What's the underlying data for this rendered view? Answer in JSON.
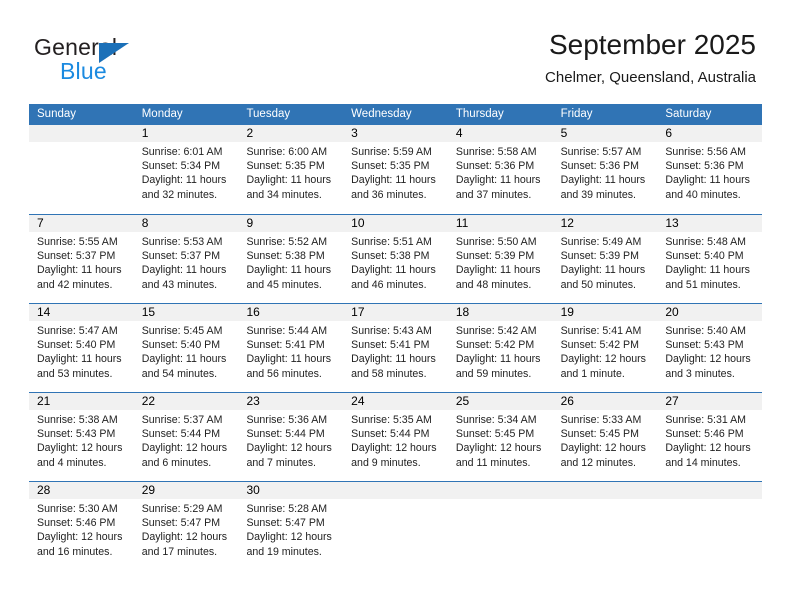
{
  "brand": {
    "name_part1": "General",
    "name_part2": "Blue",
    "triangle_color": "#1b70b8",
    "blue_text_color": "#1b8ae0"
  },
  "header": {
    "title": "September 2025",
    "location": "Chelmer, Queensland, Australia"
  },
  "theme": {
    "header_blue": "#3074b5",
    "day_number_bg": "#f1f1f1",
    "text_color": "#222222"
  },
  "weekdays": [
    "Sunday",
    "Monday",
    "Tuesday",
    "Wednesday",
    "Thursday",
    "Friday",
    "Saturday"
  ],
  "weeks": [
    [
      {
        "day": "",
        "sunrise": "",
        "sunset": "",
        "daylight_line1": "",
        "daylight_line2": ""
      },
      {
        "day": "1",
        "sunrise": "Sunrise: 6:01 AM",
        "sunset": "Sunset: 5:34 PM",
        "daylight_line1": "Daylight: 11 hours",
        "daylight_line2": "and 32 minutes."
      },
      {
        "day": "2",
        "sunrise": "Sunrise: 6:00 AM",
        "sunset": "Sunset: 5:35 PM",
        "daylight_line1": "Daylight: 11 hours",
        "daylight_line2": "and 34 minutes."
      },
      {
        "day": "3",
        "sunrise": "Sunrise: 5:59 AM",
        "sunset": "Sunset: 5:35 PM",
        "daylight_line1": "Daylight: 11 hours",
        "daylight_line2": "and 36 minutes."
      },
      {
        "day": "4",
        "sunrise": "Sunrise: 5:58 AM",
        "sunset": "Sunset: 5:36 PM",
        "daylight_line1": "Daylight: 11 hours",
        "daylight_line2": "and 37 minutes."
      },
      {
        "day": "5",
        "sunrise": "Sunrise: 5:57 AM",
        "sunset": "Sunset: 5:36 PM",
        "daylight_line1": "Daylight: 11 hours",
        "daylight_line2": "and 39 minutes."
      },
      {
        "day": "6",
        "sunrise": "Sunrise: 5:56 AM",
        "sunset": "Sunset: 5:36 PM",
        "daylight_line1": "Daylight: 11 hours",
        "daylight_line2": "and 40 minutes."
      }
    ],
    [
      {
        "day": "7",
        "sunrise": "Sunrise: 5:55 AM",
        "sunset": "Sunset: 5:37 PM",
        "daylight_line1": "Daylight: 11 hours",
        "daylight_line2": "and 42 minutes."
      },
      {
        "day": "8",
        "sunrise": "Sunrise: 5:53 AM",
        "sunset": "Sunset: 5:37 PM",
        "daylight_line1": "Daylight: 11 hours",
        "daylight_line2": "and 43 minutes."
      },
      {
        "day": "9",
        "sunrise": "Sunrise: 5:52 AM",
        "sunset": "Sunset: 5:38 PM",
        "daylight_line1": "Daylight: 11 hours",
        "daylight_line2": "and 45 minutes."
      },
      {
        "day": "10",
        "sunrise": "Sunrise: 5:51 AM",
        "sunset": "Sunset: 5:38 PM",
        "daylight_line1": "Daylight: 11 hours",
        "daylight_line2": "and 46 minutes."
      },
      {
        "day": "11",
        "sunrise": "Sunrise: 5:50 AM",
        "sunset": "Sunset: 5:39 PM",
        "daylight_line1": "Daylight: 11 hours",
        "daylight_line2": "and 48 minutes."
      },
      {
        "day": "12",
        "sunrise": "Sunrise: 5:49 AM",
        "sunset": "Sunset: 5:39 PM",
        "daylight_line1": "Daylight: 11 hours",
        "daylight_line2": "and 50 minutes."
      },
      {
        "day": "13",
        "sunrise": "Sunrise: 5:48 AM",
        "sunset": "Sunset: 5:40 PM",
        "daylight_line1": "Daylight: 11 hours",
        "daylight_line2": "and 51 minutes."
      }
    ],
    [
      {
        "day": "14",
        "sunrise": "Sunrise: 5:47 AM",
        "sunset": "Sunset: 5:40 PM",
        "daylight_line1": "Daylight: 11 hours",
        "daylight_line2": "and 53 minutes."
      },
      {
        "day": "15",
        "sunrise": "Sunrise: 5:45 AM",
        "sunset": "Sunset: 5:40 PM",
        "daylight_line1": "Daylight: 11 hours",
        "daylight_line2": "and 54 minutes."
      },
      {
        "day": "16",
        "sunrise": "Sunrise: 5:44 AM",
        "sunset": "Sunset: 5:41 PM",
        "daylight_line1": "Daylight: 11 hours",
        "daylight_line2": "and 56 minutes."
      },
      {
        "day": "17",
        "sunrise": "Sunrise: 5:43 AM",
        "sunset": "Sunset: 5:41 PM",
        "daylight_line1": "Daylight: 11 hours",
        "daylight_line2": "and 58 minutes."
      },
      {
        "day": "18",
        "sunrise": "Sunrise: 5:42 AM",
        "sunset": "Sunset: 5:42 PM",
        "daylight_line1": "Daylight: 11 hours",
        "daylight_line2": "and 59 minutes."
      },
      {
        "day": "19",
        "sunrise": "Sunrise: 5:41 AM",
        "sunset": "Sunset: 5:42 PM",
        "daylight_line1": "Daylight: 12 hours",
        "daylight_line2": "and 1 minute."
      },
      {
        "day": "20",
        "sunrise": "Sunrise: 5:40 AM",
        "sunset": "Sunset: 5:43 PM",
        "daylight_line1": "Daylight: 12 hours",
        "daylight_line2": "and 3 minutes."
      }
    ],
    [
      {
        "day": "21",
        "sunrise": "Sunrise: 5:38 AM",
        "sunset": "Sunset: 5:43 PM",
        "daylight_line1": "Daylight: 12 hours",
        "daylight_line2": "and 4 minutes."
      },
      {
        "day": "22",
        "sunrise": "Sunrise: 5:37 AM",
        "sunset": "Sunset: 5:44 PM",
        "daylight_line1": "Daylight: 12 hours",
        "daylight_line2": "and 6 minutes."
      },
      {
        "day": "23",
        "sunrise": "Sunrise: 5:36 AM",
        "sunset": "Sunset: 5:44 PM",
        "daylight_line1": "Daylight: 12 hours",
        "daylight_line2": "and 7 minutes."
      },
      {
        "day": "24",
        "sunrise": "Sunrise: 5:35 AM",
        "sunset": "Sunset: 5:44 PM",
        "daylight_line1": "Daylight: 12 hours",
        "daylight_line2": "and 9 minutes."
      },
      {
        "day": "25",
        "sunrise": "Sunrise: 5:34 AM",
        "sunset": "Sunset: 5:45 PM",
        "daylight_line1": "Daylight: 12 hours",
        "daylight_line2": "and 11 minutes."
      },
      {
        "day": "26",
        "sunrise": "Sunrise: 5:33 AM",
        "sunset": "Sunset: 5:45 PM",
        "daylight_line1": "Daylight: 12 hours",
        "daylight_line2": "and 12 minutes."
      },
      {
        "day": "27",
        "sunrise": "Sunrise: 5:31 AM",
        "sunset": "Sunset: 5:46 PM",
        "daylight_line1": "Daylight: 12 hours",
        "daylight_line2": "and 14 minutes."
      }
    ],
    [
      {
        "day": "28",
        "sunrise": "Sunrise: 5:30 AM",
        "sunset": "Sunset: 5:46 PM",
        "daylight_line1": "Daylight: 12 hours",
        "daylight_line2": "and 16 minutes."
      },
      {
        "day": "29",
        "sunrise": "Sunrise: 5:29 AM",
        "sunset": "Sunset: 5:47 PM",
        "daylight_line1": "Daylight: 12 hours",
        "daylight_line2": "and 17 minutes."
      },
      {
        "day": "30",
        "sunrise": "Sunrise: 5:28 AM",
        "sunset": "Sunset: 5:47 PM",
        "daylight_line1": "Daylight: 12 hours",
        "daylight_line2": "and 19 minutes."
      },
      {
        "day": "",
        "sunrise": "",
        "sunset": "",
        "daylight_line1": "",
        "daylight_line2": ""
      },
      {
        "day": "",
        "sunrise": "",
        "sunset": "",
        "daylight_line1": "",
        "daylight_line2": ""
      },
      {
        "day": "",
        "sunrise": "",
        "sunset": "",
        "daylight_line1": "",
        "daylight_line2": ""
      },
      {
        "day": "",
        "sunrise": "",
        "sunset": "",
        "daylight_line1": "",
        "daylight_line2": ""
      }
    ]
  ]
}
